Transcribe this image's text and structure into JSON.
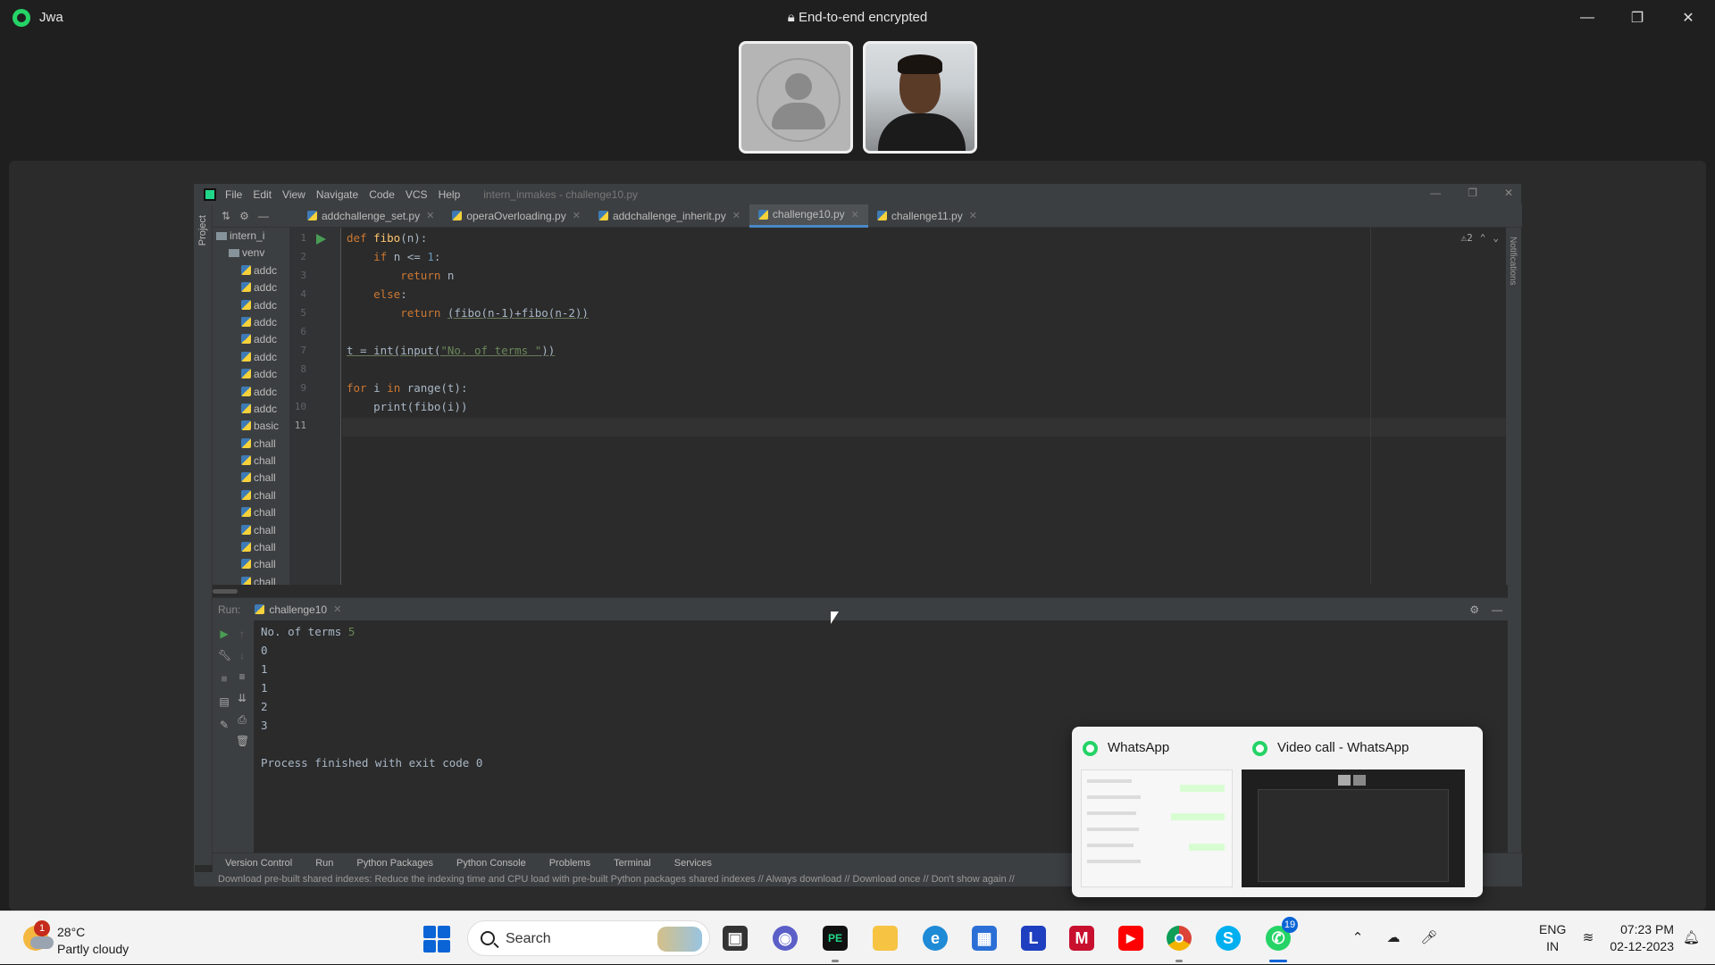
{
  "whatsapp": {
    "title": "Jwa",
    "encryption_notice": "End-to-end encrypted",
    "controls": {
      "minimize": "—",
      "restore": "❐",
      "close": "✕"
    }
  },
  "ide": {
    "menu": [
      "File",
      "Edit",
      "View",
      "Navigate",
      "Code",
      "VCS",
      "Help"
    ],
    "project_title": "intern_inmakes - challenge10.py",
    "tabs": [
      {
        "label": "addchallenge_set.py",
        "active": false
      },
      {
        "label": "operaOverloading.py",
        "active": false
      },
      {
        "label": "addchallenge_inherit.py",
        "active": false
      },
      {
        "label": "challenge10.py",
        "active": true
      },
      {
        "label": "challenge11.py",
        "active": false
      }
    ],
    "project_stripe_label": "Project",
    "notifications_stripe_label": "Notifications",
    "project_tree": [
      {
        "label": "intern_i",
        "type": "folder"
      },
      {
        "label": "venv",
        "type": "folder"
      },
      {
        "label": "addc",
        "type": "py"
      },
      {
        "label": "addc",
        "type": "py"
      },
      {
        "label": "addc",
        "type": "py"
      },
      {
        "label": "addc",
        "type": "py"
      },
      {
        "label": "addc",
        "type": "py"
      },
      {
        "label": "addc",
        "type": "py"
      },
      {
        "label": "addc",
        "type": "py"
      },
      {
        "label": "addc",
        "type": "py"
      },
      {
        "label": "addc",
        "type": "py"
      },
      {
        "label": "basic",
        "type": "py"
      },
      {
        "label": "chall",
        "type": "py"
      },
      {
        "label": "chall",
        "type": "py"
      },
      {
        "label": "chall",
        "type": "py"
      },
      {
        "label": "chall",
        "type": "py"
      },
      {
        "label": "chall",
        "type": "py"
      },
      {
        "label": "chall",
        "type": "py"
      },
      {
        "label": "chall",
        "type": "py"
      },
      {
        "label": "chall",
        "type": "py"
      },
      {
        "label": "chall",
        "type": "py"
      }
    ],
    "line_numbers": [
      "1",
      "2",
      "3",
      "4",
      "5",
      "6",
      "7",
      "8",
      "9",
      "10",
      "11"
    ],
    "code": {
      "l1_kw": "def ",
      "l1_fn": "fibo",
      "l1_rest": "(n):",
      "l2_kw": "if ",
      "l2_rest": "n <= ",
      "l2_num": "1",
      "l2_colon": ":",
      "l3_kw": "return ",
      "l3_rest": "n",
      "l4_kw": "else",
      "l4_rest": ":",
      "l5_kw": "return ",
      "l5_rest": "(fibo(n-1)+fibo(n-2))",
      "l7_a": "t = int(input(",
      "l7_str": "\"No. of terms \"",
      "l7_b": "))",
      "l9_kw1": "for ",
      "l9_a": "i ",
      "l9_kw2": "in ",
      "l9_b": "range(t):",
      "l10": "print(fibo(i))"
    },
    "inspection_count": "⚠2",
    "run": {
      "label": "Run:",
      "tab": "challenge10",
      "console": {
        "prompt": "No. of terms ",
        "input": "5",
        "outputs": [
          "0",
          "1",
          "1",
          "2",
          "3"
        ],
        "exit": "Process finished with exit code 0"
      }
    },
    "tool_windows": [
      "Version Control",
      "Run",
      "Python Packages",
      "Python Console",
      "Problems",
      "Terminal",
      "Services"
    ],
    "status_message": "Download pre-built shared indexes: Reduce the indexing time and CPU load with pre-built Python packages shared indexes // Always download // Download once // Don't show again //"
  },
  "preview": {
    "cards": [
      {
        "title": "WhatsApp"
      },
      {
        "title": "Video call - WhatsApp"
      }
    ]
  },
  "taskbar": {
    "weather": {
      "badge": "1",
      "temp": "28°C",
      "desc": "Partly cloudy"
    },
    "search_label": "Search",
    "apps": [
      {
        "name": "task-view",
        "color": "#333333",
        "glyph": "▣"
      },
      {
        "name": "chat",
        "color": "#5b5fc7",
        "glyph": "◉"
      },
      {
        "name": "pycharm",
        "color": "#111111",
        "glyph": "PE"
      },
      {
        "name": "file-explorer",
        "color": "#f6c343",
        "glyph": "▬"
      },
      {
        "name": "edge",
        "color": "#1f8ad6",
        "glyph": "e"
      },
      {
        "name": "store",
        "color": "#2b6fd6",
        "glyph": "▦"
      },
      {
        "name": "app-l",
        "color": "#1e3fbf",
        "glyph": "L"
      },
      {
        "name": "mcafee",
        "color": "#c8102e",
        "glyph": "M"
      },
      {
        "name": "youtube",
        "color": "#ff0000",
        "glyph": "▶"
      },
      {
        "name": "chrome",
        "color": "#3cba54",
        "glyph": "●"
      },
      {
        "name": "skype",
        "color": "#00aff0",
        "glyph": "S"
      },
      {
        "name": "whatsapp",
        "color": "#25d366",
        "glyph": "✆",
        "badge": "19"
      }
    ],
    "lang": {
      "line1": "ENG",
      "line2": "IN"
    },
    "clock": {
      "time": "07:23 PM",
      "date": "02-12-2023"
    }
  }
}
